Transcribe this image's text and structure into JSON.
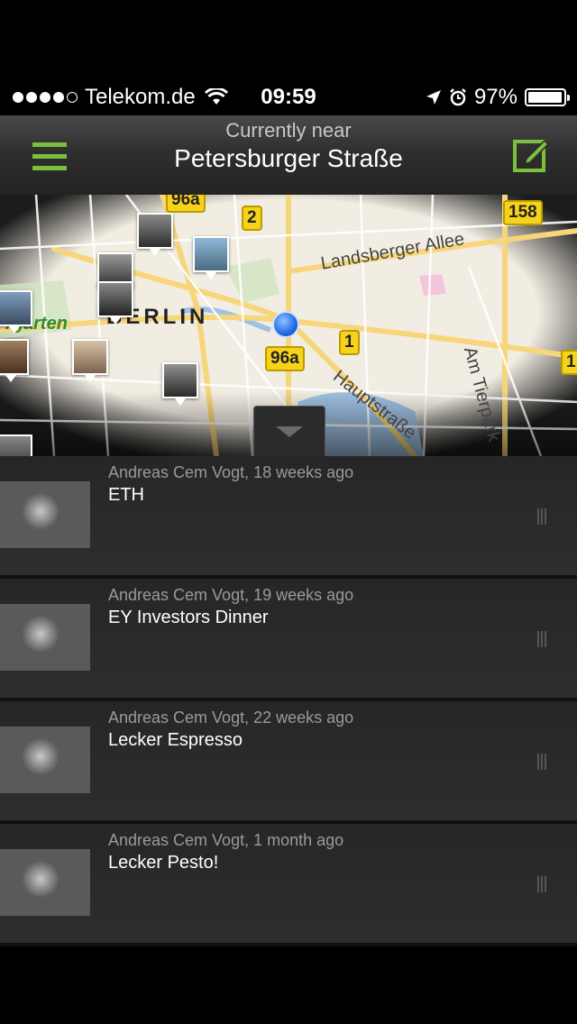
{
  "status_bar": {
    "carrier": "Telekom.de",
    "time": "09:59",
    "battery": "97%",
    "battery_level": 0.97,
    "signal_bars": 4,
    "signal_max": 5
  },
  "nav": {
    "subtitle": "Currently near",
    "title": "Petersburger Straße",
    "accent_color": "#7cbf3b"
  },
  "map": {
    "labels": {
      "city": "BERLIN",
      "landsberger": "Landsberger Allee",
      "hauptstrasse": "Hauptstraße",
      "tierpark": "Am Tierpark",
      "garten": "rgarten"
    },
    "route_badges": [
      "96a",
      "2",
      "158",
      "1",
      "96a",
      "1"
    ]
  },
  "posts": [
    {
      "author_time": "Andreas Cem Vogt, 18 weeks ago",
      "title": "ETH"
    },
    {
      "author_time": "Andreas Cem Vogt, 19 weeks ago",
      "title": "EY Investors Dinner"
    },
    {
      "author_time": "Andreas Cem Vogt, 22 weeks ago",
      "title": "Lecker Espresso"
    },
    {
      "author_time": "Andreas Cem Vogt, 1 month ago",
      "title": "Lecker Pesto!"
    }
  ]
}
